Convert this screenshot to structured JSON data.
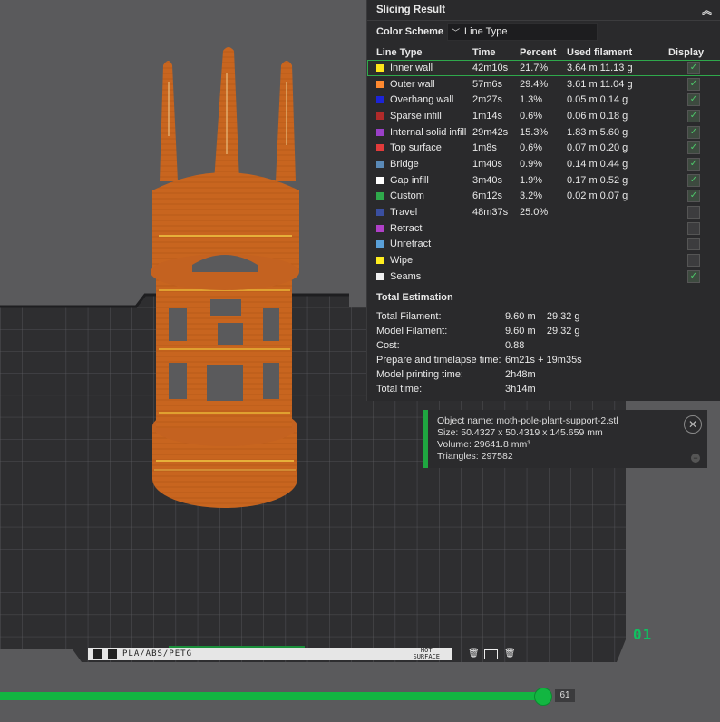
{
  "panel": {
    "title": "Slicing Result",
    "collapse_icon": "chevron-up-icon",
    "color_scheme_label": "Color Scheme",
    "color_scheme_value": "Line Type",
    "columns": {
      "type": "Line Type",
      "time": "Time",
      "percent": "Percent",
      "filament": "Used filament",
      "display": "Display"
    },
    "rows": [
      {
        "name": "Inner wall",
        "color": "#ffe61a",
        "time": "42m10s",
        "percent": "21.7%",
        "filament": "3.64 m   11.13 g",
        "checked": true,
        "selected": true
      },
      {
        "name": "Outer wall",
        "color": "#ff8a30",
        "time": "57m6s",
        "percent": "29.4%",
        "filament": "3.61 m   11.04 g",
        "checked": true
      },
      {
        "name": "Overhang wall",
        "color": "#1c24d8",
        "time": "2m27s",
        "percent": "1.3%",
        "filament": "0.05 m   0.14 g",
        "checked": true
      },
      {
        "name": "Sparse infill",
        "color": "#b02a2a",
        "time": "1m14s",
        "percent": "0.6%",
        "filament": "0.06 m   0.18 g",
        "checked": true
      },
      {
        "name": "Internal solid infill",
        "color": "#9a40c8",
        "time": "29m42s",
        "percent": "15.3%",
        "filament": "1.83 m   5.60 g",
        "checked": true
      },
      {
        "name": "Top surface",
        "color": "#e23b3b",
        "time": "1m8s",
        "percent": "0.6%",
        "filament": "0.07 m   0.20 g",
        "checked": true
      },
      {
        "name": "Bridge",
        "color": "#5a8ab8",
        "time": "1m40s",
        "percent": "0.9%",
        "filament": "0.14 m   0.44 g",
        "checked": true
      },
      {
        "name": "Gap infill",
        "color": "#ffffff",
        "time": "3m40s",
        "percent": "1.9%",
        "filament": "0.17 m   0.52 g",
        "checked": true
      },
      {
        "name": "Custom",
        "color": "#2fa94b",
        "time": "6m12s",
        "percent": "3.2%",
        "filament": "0.02 m   0.07 g",
        "checked": true
      },
      {
        "name": "Travel",
        "color": "#3a4fa0",
        "time": "48m37s",
        "percent": "25.0%",
        "filament": "",
        "checked": false
      },
      {
        "name": "Retract",
        "color": "#b040c8",
        "time": "",
        "percent": "",
        "filament": "",
        "checked": false
      },
      {
        "name": "Unretract",
        "color": "#5aa0d8",
        "time": "",
        "percent": "",
        "filament": "",
        "checked": false
      },
      {
        "name": "Wipe",
        "color": "#ffee20",
        "time": "",
        "percent": "",
        "filament": "",
        "checked": false
      },
      {
        "name": "Seams",
        "color": "#f0f0f0",
        "time": "",
        "percent": "",
        "filament": "",
        "checked": true
      }
    ],
    "total_title": "Total Estimation",
    "totals": [
      {
        "label": "Total Filament:",
        "value": "9.60 m    29.32 g"
      },
      {
        "label": "Model Filament:",
        "value": "9.60 m    29.32 g"
      },
      {
        "label": "Cost:",
        "value": "0.88"
      },
      {
        "label": "Prepare and timelapse time:",
        "value": "6m21s + 19m35s"
      },
      {
        "label": "Model printing time:",
        "value": "2h48m"
      },
      {
        "label": "Total time:",
        "value": "3h14m"
      }
    ]
  },
  "object_info": {
    "name": "Object name: moth-pole-plant-support-2.stl",
    "size": "Size: 50.4327 x 50.4319 x 145.659 mm",
    "volume": "Volume: 29641.8 mm³",
    "triangles": "Triangles: 297582"
  },
  "bed": {
    "material_label": "PLA/ABS/PETG",
    "hot_label_1": "HOT",
    "hot_label_2": "SURFACE",
    "plate_number": "01"
  },
  "slider": {
    "value": "61"
  },
  "colors": {
    "accent": "#12b641",
    "model": "#c8651f",
    "panel_bg": "#2a2a2c"
  }
}
